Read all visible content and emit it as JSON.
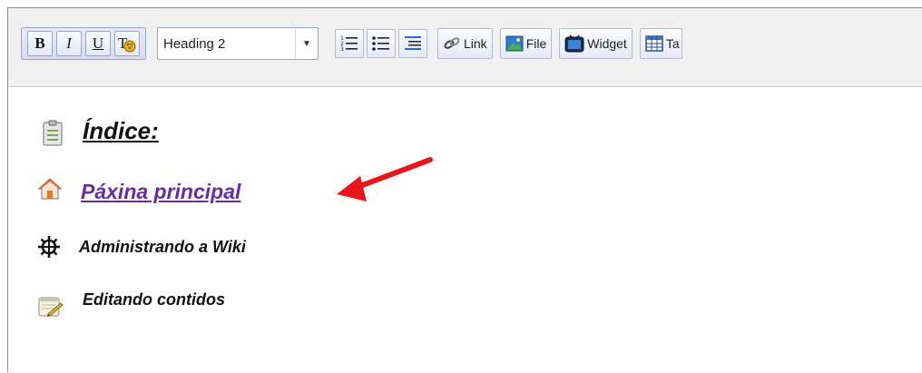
{
  "toolbar": {
    "bold_label": "B",
    "italic_label": "I",
    "underline_label": "U",
    "format_select": {
      "value": "Heading 2"
    },
    "link_label": "Link",
    "file_label": "File",
    "widget_label": "Widget",
    "table_label": "Ta"
  },
  "content": {
    "heading": "Índice:",
    "main_page_link": "Páxina principal",
    "admin_item": "Administrando a Wiki",
    "edit_item": "Editando contidos"
  },
  "colors": {
    "link": "#6b2d9b",
    "annotation_arrow": "#e8161b"
  }
}
